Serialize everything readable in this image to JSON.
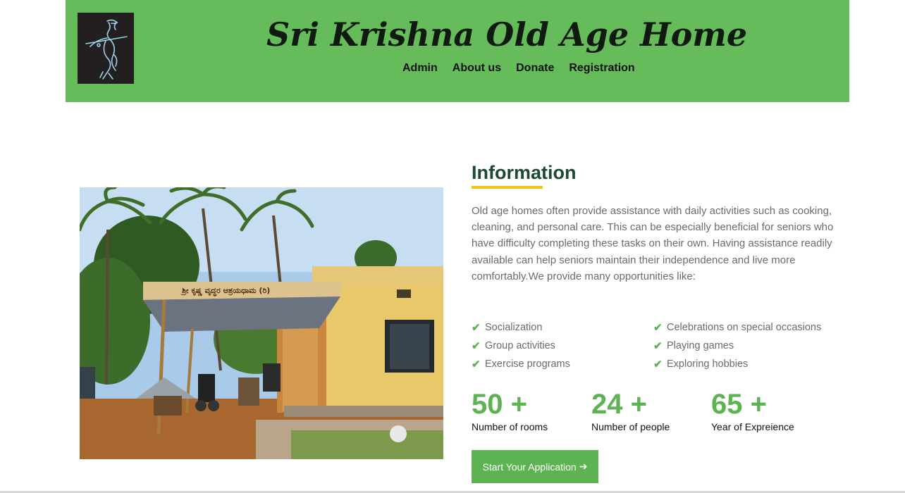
{
  "header": {
    "site_title": "Sri Krishna Old Age Home",
    "logo_icon": "krishna-flute-logo",
    "background_color": "#66bb5a",
    "nav": [
      {
        "label": "Admin"
      },
      {
        "label": "About us"
      },
      {
        "label": "Donate"
      },
      {
        "label": "Registration"
      }
    ]
  },
  "main": {
    "photo_sign_text": "ಶ್ರೀ ಕೃಷ್ಣ ವೃದ್ಧರ ಆಶ್ರಯಧಾಮ (ರಿ)",
    "info": {
      "title": "Information",
      "accent_color": "#f1c40f",
      "paragraph": "Old age homes often provide assistance with daily activities such as cooking, cleaning, and personal care. This can be especially beneficial for seniors who have difficulty completing these tasks on their own. Having assistance readily available can help seniors maintain their independence and live more comfortably.We provide many opportunities like:"
    },
    "features": [
      {
        "icon": "check-icon",
        "label": "Socialization"
      },
      {
        "icon": "check-icon",
        "label": "Celebrations on special occasions"
      },
      {
        "icon": "check-icon",
        "label": "Group activities"
      },
      {
        "icon": "check-icon",
        "label": "Playing games"
      },
      {
        "icon": "check-icon",
        "label": "Exercise programs"
      },
      {
        "icon": "check-icon",
        "label": "Exploring hobbies"
      }
    ],
    "stats": [
      {
        "value": "50 +",
        "label": "Number of rooms"
      },
      {
        "value": "24 +",
        "label": "Number of people"
      },
      {
        "value": "65 +",
        "label": "Year of Expreience"
      }
    ],
    "cta": {
      "label": "Start Your Application",
      "icon": "arrow-right-icon",
      "color": "#5db352"
    }
  }
}
